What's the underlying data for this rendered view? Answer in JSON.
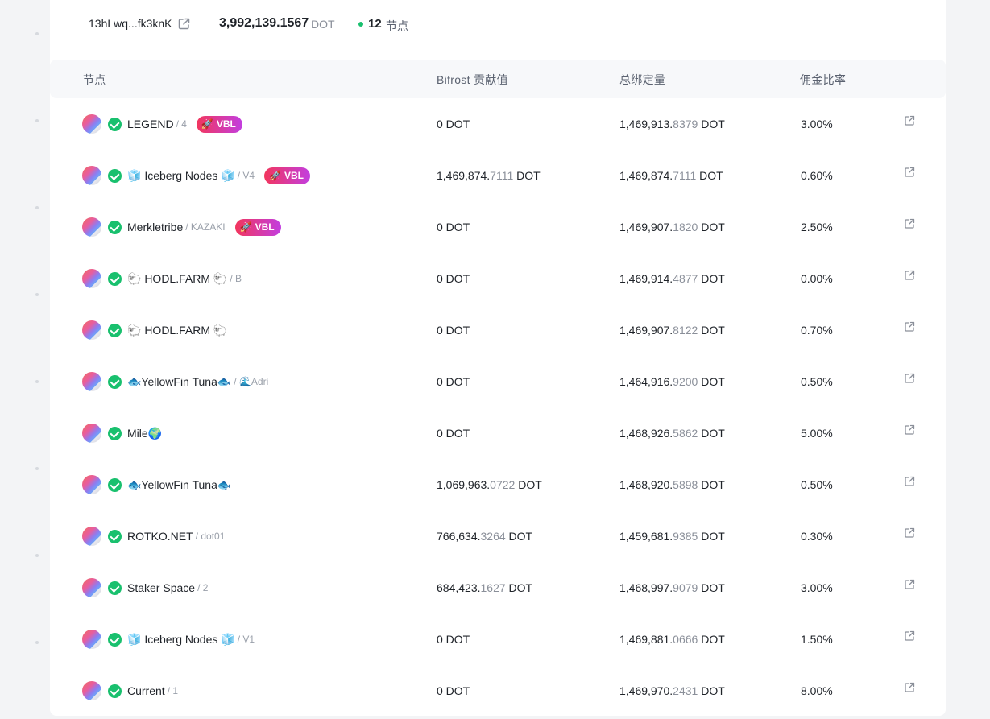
{
  "summary": {
    "address": "13hLwq...fk3knK",
    "total_amount": "3,992,139.1567",
    "total_unit": "DOT",
    "node_count": "12",
    "node_count_label": "节点",
    "status_color": "#19c06e"
  },
  "table": {
    "headers": {
      "node": "节点",
      "bifrost": "Bifrost 贡献值",
      "bonded": "总绑定量",
      "commission": "佣金比率"
    },
    "rows": [
      {
        "name": "LEGEND",
        "sub": "/ 4",
        "badge": "VBL",
        "bif_int": "0",
        "bif_dec": "",
        "bif_unit": "DOT",
        "bond_int": "1,469,913.",
        "bond_dec": "8379",
        "bond_unit": "DOT",
        "commission": "3.00%"
      },
      {
        "name": "🧊 Iceberg Nodes 🧊",
        "sub": "/ V4",
        "badge": "VBL",
        "bif_int": "1,469,874.",
        "bif_dec": "7111",
        "bif_unit": "DOT",
        "bond_int": "1,469,874.",
        "bond_dec": "7111",
        "bond_unit": "DOT",
        "commission": "0.60%"
      },
      {
        "name": "Merkletribe",
        "sub": "/ KAZAKI",
        "badge": "VBL",
        "bif_int": "0",
        "bif_dec": "",
        "bif_unit": "DOT",
        "bond_int": "1,469,907.",
        "bond_dec": "1820",
        "bond_unit": "DOT",
        "commission": "2.50%"
      },
      {
        "name": "🐑 HODL.FARM 🐑",
        "sub": "/ B",
        "badge": "",
        "bif_int": "0",
        "bif_dec": "",
        "bif_unit": "DOT",
        "bond_int": "1,469,914.",
        "bond_dec": "4877",
        "bond_unit": "DOT",
        "commission": "0.00%"
      },
      {
        "name": "🐑 HODL.FARM 🐑",
        "sub": "",
        "badge": "",
        "bif_int": "0",
        "bif_dec": "",
        "bif_unit": "DOT",
        "bond_int": "1,469,907.",
        "bond_dec": "8122",
        "bond_unit": "DOT",
        "commission": "0.70%"
      },
      {
        "name": "🐟YellowFin Tuna🐟",
        "sub": "/ 🌊Adri",
        "badge": "",
        "bif_int": "0",
        "bif_dec": "",
        "bif_unit": "DOT",
        "bond_int": "1,464,916.",
        "bond_dec": "9200",
        "bond_unit": "DOT",
        "commission": "0.50%"
      },
      {
        "name": "Mile🌍",
        "sub": "",
        "badge": "",
        "bif_int": "0",
        "bif_dec": "",
        "bif_unit": "DOT",
        "bond_int": "1,468,926.",
        "bond_dec": "5862",
        "bond_unit": "DOT",
        "commission": "5.00%"
      },
      {
        "name": "🐟YellowFin Tuna🐟",
        "sub": "",
        "badge": "",
        "bif_int": "1,069,963.",
        "bif_dec": "0722",
        "bif_unit": "DOT",
        "bond_int": "1,468,920.",
        "bond_dec": "5898",
        "bond_unit": "DOT",
        "commission": "0.50%"
      },
      {
        "name": "ROTKO.NET",
        "sub": "/ dot01",
        "badge": "",
        "bif_int": "766,634.",
        "bif_dec": "3264",
        "bif_unit": "DOT",
        "bond_int": "1,459,681.",
        "bond_dec": "9385",
        "bond_unit": "DOT",
        "commission": "0.30%"
      },
      {
        "name": "Staker Space",
        "sub": "/ 2",
        "badge": "",
        "bif_int": "684,423.",
        "bif_dec": "1627",
        "bif_unit": "DOT",
        "bond_int": "1,468,997.",
        "bond_dec": "9079",
        "bond_unit": "DOT",
        "commission": "3.00%"
      },
      {
        "name": "🧊 Iceberg Nodes 🧊",
        "sub": "/ V1",
        "badge": "",
        "bif_int": "0",
        "bif_dec": "",
        "bif_unit": "DOT",
        "bond_int": "1,469,881.",
        "bond_dec": "0666",
        "bond_unit": "DOT",
        "commission": "1.50%"
      },
      {
        "name": "Current",
        "sub": "/ 1",
        "badge": "",
        "bif_int": "0",
        "bif_dec": "",
        "bif_unit": "DOT",
        "bond_int": "1,469,970.",
        "bond_dec": "2431",
        "bond_unit": "DOT",
        "commission": "8.00%"
      }
    ]
  },
  "icons": {
    "external_link": "external-link-icon",
    "verified": "check-circle-icon",
    "rocket": "rocket-icon"
  }
}
